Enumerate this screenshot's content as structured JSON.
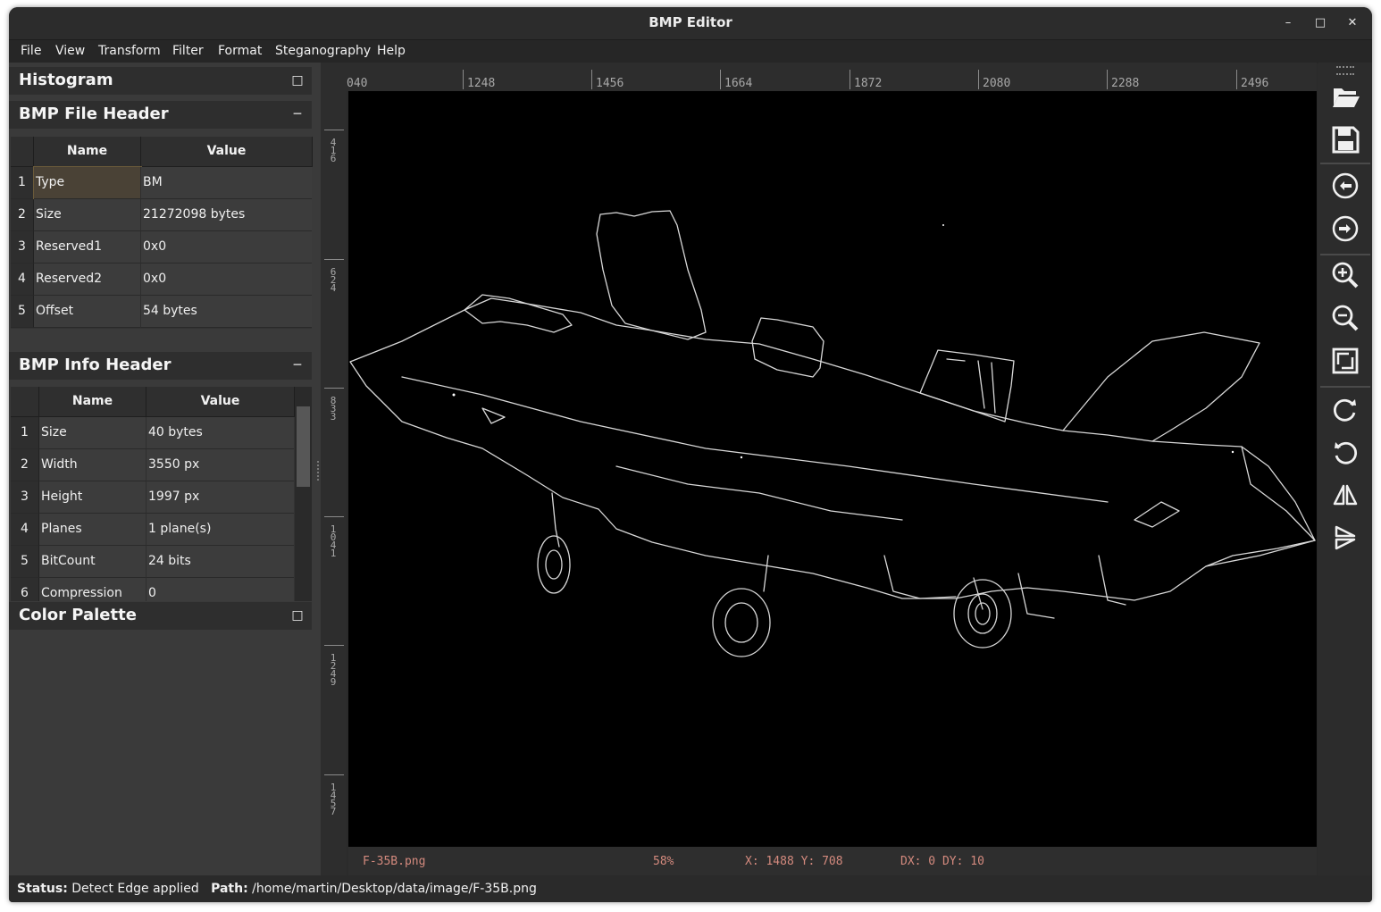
{
  "window": {
    "title": "BMP Editor"
  },
  "menu": [
    "File",
    "View",
    "Transform",
    "Filter",
    "Format",
    "Steganography",
    "Help"
  ],
  "docks": {
    "histogram": {
      "title": "Histogram"
    },
    "file_header": {
      "title": "BMP File Header",
      "columns": [
        "Name",
        "Value"
      ],
      "rows": [
        {
          "num": "1",
          "name": "Type",
          "value": "BM"
        },
        {
          "num": "2",
          "name": "Size",
          "value": "21272098 bytes"
        },
        {
          "num": "3",
          "name": "Reserved1",
          "value": "0x0"
        },
        {
          "num": "4",
          "name": "Reserved2",
          "value": "0x0"
        },
        {
          "num": "5",
          "name": "Offset",
          "value": "54 bytes"
        }
      ]
    },
    "info_header": {
      "title": "BMP Info Header",
      "columns": [
        "Name",
        "Value"
      ],
      "rows": [
        {
          "num": "1",
          "name": "Size",
          "value": "40 bytes"
        },
        {
          "num": "2",
          "name": "Width",
          "value": "3550 px"
        },
        {
          "num": "3",
          "name": "Height",
          "value": "1997 px"
        },
        {
          "num": "4",
          "name": "Planes",
          "value": "1 plane(s)"
        },
        {
          "num": "5",
          "name": "BitCount",
          "value": "24 bits"
        },
        {
          "num": "6",
          "name": "Compression",
          "value": "0"
        }
      ]
    },
    "color_palette": {
      "title": "Color Palette"
    }
  },
  "ruler": {
    "top": [
      "040",
      "1248",
      "1456",
      "1664",
      "1872",
      "2080",
      "2288",
      "2496"
    ],
    "left": [
      "416",
      "624",
      "833",
      "1041",
      "1249",
      "1457"
    ]
  },
  "canvas_info": {
    "filename": "F-35B.png",
    "zoom": "58%",
    "coords": "X: 1488 Y: 708",
    "delta": "DX: 0 DY: 10"
  },
  "status": {
    "status_label": "Status:",
    "status_value": "Detect Edge applied",
    "path_label": "Path:",
    "path_value": "/home/martin/Desktop/data/image/F-35B.png"
  },
  "toolbar_icons": [
    "open-folder-icon",
    "save-icon",
    "undo-icon",
    "redo-icon",
    "zoom-in-icon",
    "zoom-out-icon",
    "fit-screen-icon",
    "rotate-cw-icon",
    "rotate-ccw-icon",
    "flip-horizontal-icon",
    "flip-vertical-icon"
  ]
}
